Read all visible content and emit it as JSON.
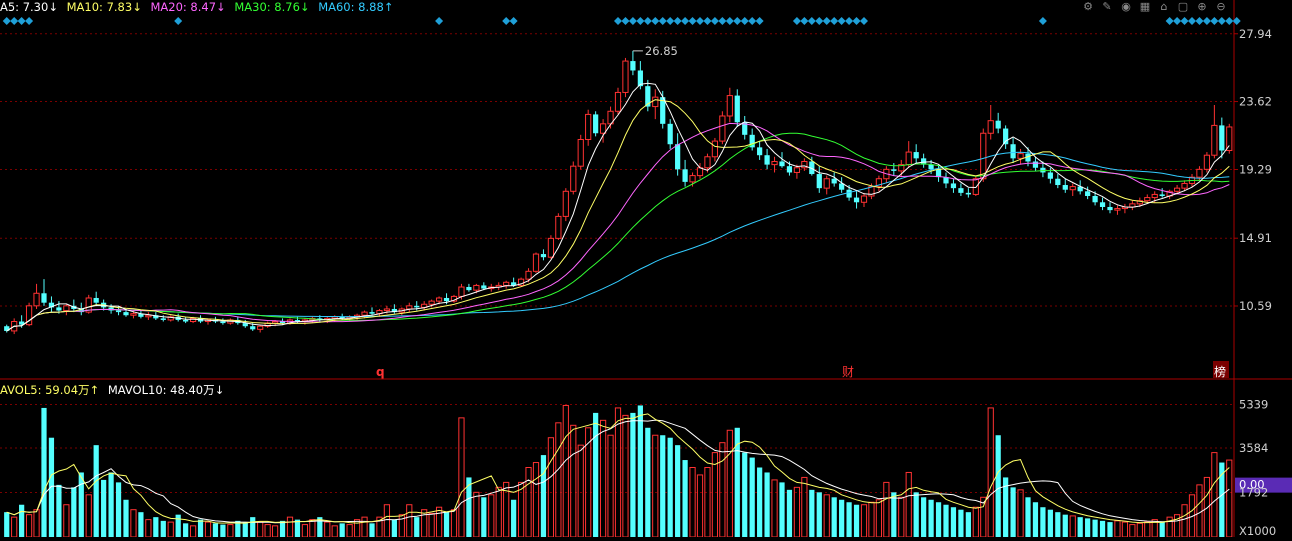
{
  "price_legend": [
    {
      "label": "A5: 7.30",
      "arrow": "↓",
      "color": "#ffffff"
    },
    {
      "label": "MA10: 7.83",
      "arrow": "↓",
      "color": "#ffff66"
    },
    {
      "label": "MA20: 8.47",
      "arrow": "↓",
      "color": "#ff66ff"
    },
    {
      "label": "MA30: 8.76",
      "arrow": "↓",
      "color": "#33ff33"
    },
    {
      "label": "MA60: 8.88",
      "arrow": "↑",
      "color": "#33ccff"
    }
  ],
  "vol_legend": [
    {
      "label": "AVOL5: 59.04万",
      "arrow": "↑",
      "color": "#ffff66"
    },
    {
      "label": "MAVOL10: 48.40万",
      "arrow": "↓",
      "color": "#ffffff"
    }
  ],
  "toolbar_icons": [
    "gear-icon",
    "pen-icon",
    "eye-icon",
    "calendar-icon",
    "house-icon",
    "lock-icon",
    "plus-icon",
    "minus-icon"
  ],
  "markers": {
    "q": "q",
    "cai": "财",
    "bang": "榜"
  },
  "high_label": "26.85",
  "price_axis": [
    "27.94",
    "23.62",
    "19.29",
    "14.91",
    "10.59"
  ],
  "vol_axis": [
    "5339",
    "3584",
    "0.00",
    "1792",
    "X1000"
  ],
  "colors": {
    "up": "#ff3232",
    "down": "#54ffff",
    "grid": "#7a0000",
    "axis": "#aa0000",
    "diamond": "#1fa0d8"
  },
  "chart_data": {
    "type": "candlestick",
    "price_ylim": [
      6.0,
      29.2
    ],
    "vol_ylim": [
      0,
      5600
    ],
    "price_ticks": [
      27.94,
      23.62,
      19.29,
      14.91,
      10.59
    ],
    "vol_ticks": [
      5339,
      3584,
      1792
    ],
    "volume_unit": "X1000",
    "bars": [
      [
        9.3,
        9.4,
        8.9,
        9.0,
        1000
      ],
      [
        9.0,
        9.8,
        8.8,
        9.6,
        800
      ],
      [
        9.6,
        10.0,
        9.2,
        9.4,
        1300
      ],
      [
        9.4,
        10.8,
        9.3,
        10.6,
        900
      ],
      [
        10.6,
        12.0,
        10.4,
        11.4,
        1100
      ],
      [
        11.4,
        12.3,
        10.6,
        10.8,
        5200
      ],
      [
        10.8,
        11.2,
        10.2,
        10.5,
        4000
      ],
      [
        10.5,
        10.9,
        10.1,
        10.3,
        2100
      ],
      [
        10.3,
        10.7,
        10.0,
        10.6,
        1300
      ],
      [
        10.6,
        11.0,
        10.2,
        10.4,
        2000
      ],
      [
        10.4,
        10.8,
        10.0,
        10.2,
        2600
      ],
      [
        10.2,
        11.3,
        10.1,
        11.1,
        1700
      ],
      [
        11.1,
        11.5,
        10.6,
        10.8,
        3700
      ],
      [
        10.8,
        11.0,
        10.3,
        10.5,
        2300
      ],
      [
        10.5,
        10.7,
        10.1,
        10.3,
        2600
      ],
      [
        10.3,
        10.6,
        10.0,
        10.2,
        2200
      ],
      [
        10.2,
        10.4,
        9.9,
        10.0,
        1500
      ],
      [
        10.0,
        10.3,
        9.8,
        10.1,
        1100
      ],
      [
        10.1,
        10.3,
        9.8,
        9.9,
        1000
      ],
      [
        9.9,
        10.2,
        9.7,
        10.0,
        700
      ],
      [
        10.0,
        10.2,
        9.7,
        9.8,
        800
      ],
      [
        9.8,
        10.0,
        9.6,
        9.7,
        650
      ],
      [
        9.7,
        10.0,
        9.6,
        9.9,
        600
      ],
      [
        9.9,
        10.1,
        9.6,
        9.7,
        900
      ],
      [
        9.7,
        9.9,
        9.5,
        9.6,
        550
      ],
      [
        9.6,
        9.9,
        9.5,
        9.8,
        450
      ],
      [
        9.8,
        10.0,
        9.5,
        9.6,
        700
      ],
      [
        9.6,
        9.8,
        9.4,
        9.7,
        600
      ],
      [
        9.7,
        9.9,
        9.5,
        9.6,
        550
      ],
      [
        9.6,
        9.8,
        9.4,
        9.5,
        500
      ],
      [
        9.5,
        9.8,
        9.4,
        9.7,
        500
      ],
      [
        9.7,
        9.9,
        9.4,
        9.5,
        650
      ],
      [
        9.5,
        9.7,
        9.2,
        9.3,
        600
      ],
      [
        9.3,
        9.5,
        9.0,
        9.1,
        800
      ],
      [
        9.1,
        9.4,
        8.9,
        9.3,
        600
      ],
      [
        9.3,
        9.6,
        9.2,
        9.5,
        500
      ],
      [
        9.5,
        9.7,
        9.3,
        9.6,
        450
      ],
      [
        9.6,
        9.8,
        9.4,
        9.5,
        650
      ],
      [
        9.5,
        9.8,
        9.4,
        9.7,
        800
      ],
      [
        9.7,
        9.9,
        9.5,
        9.6,
        700
      ],
      [
        9.6,
        9.8,
        9.4,
        9.7,
        500
      ],
      [
        9.7,
        9.9,
        9.5,
        9.8,
        700
      ],
      [
        9.8,
        10.0,
        9.6,
        9.7,
        800
      ],
      [
        9.7,
        9.9,
        9.5,
        9.8,
        600
      ],
      [
        9.8,
        10.0,
        9.6,
        9.9,
        450
      ],
      [
        9.9,
        10.1,
        9.7,
        9.8,
        550
      ],
      [
        9.8,
        10.0,
        9.6,
        9.9,
        500
      ],
      [
        9.9,
        10.1,
        9.7,
        10.0,
        700
      ],
      [
        10.0,
        10.3,
        9.8,
        10.2,
        800
      ],
      [
        10.2,
        10.5,
        10.0,
        10.1,
        550
      ],
      [
        10.1,
        10.4,
        9.9,
        10.3,
        800
      ],
      [
        10.3,
        10.6,
        10.1,
        10.4,
        1300
      ],
      [
        10.4,
        10.7,
        10.1,
        10.2,
        700
      ],
      [
        10.2,
        10.5,
        10.0,
        10.4,
        900
      ],
      [
        10.4,
        10.8,
        10.2,
        10.6,
        1300
      ],
      [
        10.6,
        10.9,
        10.3,
        10.5,
        800
      ],
      [
        10.5,
        10.9,
        10.3,
        10.7,
        1100
      ],
      [
        10.7,
        11.0,
        10.5,
        10.9,
        950
      ],
      [
        10.9,
        11.2,
        10.7,
        11.1,
        1200
      ],
      [
        11.1,
        11.4,
        10.7,
        10.9,
        1000
      ],
      [
        10.9,
        11.3,
        10.8,
        11.2,
        1100
      ],
      [
        11.2,
        12.0,
        11.0,
        11.8,
        4800
      ],
      [
        11.8,
        12.0,
        11.5,
        11.6,
        2400
      ],
      [
        11.6,
        12.0,
        11.4,
        11.9,
        1800
      ],
      [
        11.9,
        12.1,
        11.6,
        11.7,
        1600
      ],
      [
        11.7,
        12.0,
        11.5,
        11.8,
        1700
      ],
      [
        11.8,
        12.1,
        11.6,
        11.9,
        2000
      ],
      [
        11.9,
        12.2,
        11.7,
        12.1,
        2200
      ],
      [
        12.1,
        12.4,
        11.8,
        11.9,
        1500
      ],
      [
        11.9,
        12.4,
        11.8,
        12.3,
        2200
      ],
      [
        12.3,
        13.0,
        12.1,
        12.8,
        2800
      ],
      [
        12.8,
        14.0,
        12.7,
        13.9,
        3000
      ],
      [
        13.9,
        14.2,
        13.5,
        13.7,
        3300
      ],
      [
        13.7,
        15.1,
        13.6,
        14.9,
        4000
      ],
      [
        14.9,
        16.5,
        14.8,
        16.3,
        4600
      ],
      [
        16.3,
        18.1,
        16.0,
        17.9,
        5300
      ],
      [
        17.9,
        19.8,
        17.7,
        19.5,
        4500
      ],
      [
        19.5,
        21.5,
        19.3,
        21.2,
        3700
      ],
      [
        21.2,
        23.1,
        20.8,
        22.8,
        4400
      ],
      [
        22.8,
        23.0,
        21.4,
        21.6,
        5000
      ],
      [
        21.6,
        22.5,
        21.0,
        22.2,
        4700
      ],
      [
        22.2,
        23.3,
        21.9,
        23.0,
        4100
      ],
      [
        23.0,
        24.5,
        22.8,
        24.2,
        5200
      ],
      [
        24.2,
        26.4,
        23.9,
        26.2,
        4900
      ],
      [
        26.2,
        26.85,
        25.3,
        25.6,
        5000
      ],
      [
        25.6,
        26.2,
        24.4,
        24.6,
        5300
      ],
      [
        24.6,
        25.0,
        23.0,
        23.3,
        4400
      ],
      [
        23.3,
        24.4,
        22.5,
        23.9,
        4100
      ],
      [
        23.9,
        24.3,
        21.9,
        22.2,
        4100
      ],
      [
        22.2,
        22.5,
        20.6,
        20.9,
        4000
      ],
      [
        20.9,
        21.6,
        18.9,
        19.3,
        3700
      ],
      [
        19.3,
        19.9,
        18.2,
        18.5,
        3100
      ],
      [
        18.5,
        19.1,
        18.2,
        18.9,
        2800
      ],
      [
        18.9,
        19.7,
        18.7,
        19.4,
        2500
      ],
      [
        19.4,
        20.3,
        19.1,
        20.1,
        2800
      ],
      [
        20.1,
        21.3,
        19.8,
        21.1,
        3400
      ],
      [
        21.1,
        23.0,
        20.9,
        22.7,
        3800
      ],
      [
        22.7,
        24.5,
        22.3,
        24.0,
        4300
      ],
      [
        24.0,
        24.4,
        22.0,
        22.3,
        4400
      ],
      [
        22.3,
        22.7,
        21.2,
        21.5,
        3400
      ],
      [
        21.5,
        21.9,
        20.5,
        20.7,
        3200
      ],
      [
        20.7,
        21.1,
        19.9,
        20.2,
        2800
      ],
      [
        20.2,
        20.6,
        19.3,
        19.6,
        2600
      ],
      [
        19.6,
        20.1,
        19.1,
        19.8,
        2300
      ],
      [
        19.8,
        20.4,
        19.4,
        19.5,
        2200
      ],
      [
        19.5,
        19.8,
        18.9,
        19.1,
        1900
      ],
      [
        19.1,
        19.6,
        18.7,
        19.4,
        2000
      ],
      [
        19.4,
        20.0,
        19.2,
        19.8,
        2400
      ],
      [
        19.8,
        20.1,
        18.9,
        19.0,
        1900
      ],
      [
        19.0,
        19.5,
        17.8,
        18.1,
        1800
      ],
      [
        18.1,
        18.9,
        17.7,
        18.7,
        1700
      ],
      [
        18.7,
        19.1,
        18.2,
        18.4,
        1600
      ],
      [
        18.4,
        18.8,
        17.8,
        18.0,
        1500
      ],
      [
        18.0,
        18.3,
        17.3,
        17.5,
        1400
      ],
      [
        17.5,
        17.9,
        16.8,
        17.2,
        1300
      ],
      [
        17.2,
        17.8,
        16.9,
        17.6,
        1300
      ],
      [
        17.6,
        18.4,
        17.4,
        18.2,
        1400
      ],
      [
        18.2,
        18.9,
        17.9,
        18.7,
        1500
      ],
      [
        18.7,
        19.5,
        18.4,
        19.3,
        2200
      ],
      [
        19.3,
        19.7,
        18.9,
        19.2,
        1800
      ],
      [
        19.2,
        19.9,
        18.8,
        19.6,
        1600
      ],
      [
        19.6,
        21.1,
        19.4,
        20.4,
        2600
      ],
      [
        20.4,
        20.9,
        19.7,
        20.0,
        1800
      ],
      [
        20.0,
        20.3,
        19.4,
        19.6,
        1600
      ],
      [
        19.6,
        19.9,
        19.0,
        19.3,
        1500
      ],
      [
        19.3,
        19.6,
        18.5,
        18.8,
        1400
      ],
      [
        18.8,
        19.1,
        18.1,
        18.4,
        1300
      ],
      [
        18.4,
        18.7,
        17.8,
        18.1,
        1200
      ],
      [
        18.1,
        18.4,
        17.6,
        17.8,
        1100
      ],
      [
        17.8,
        18.1,
        17.5,
        17.7,
        1000
      ],
      [
        17.7,
        18.9,
        17.6,
        18.7,
        1200
      ],
      [
        18.7,
        21.9,
        18.5,
        21.6,
        1600
      ],
      [
        21.6,
        23.4,
        21.2,
        22.4,
        5200
      ],
      [
        22.4,
        22.9,
        21.6,
        21.9,
        4100
      ],
      [
        21.9,
        22.1,
        20.6,
        20.9,
        2400
      ],
      [
        20.9,
        21.3,
        19.7,
        20.0,
        2000
      ],
      [
        20.0,
        20.6,
        19.6,
        20.3,
        1900
      ],
      [
        20.3,
        20.7,
        19.5,
        19.8,
        1600
      ],
      [
        19.8,
        20.1,
        19.2,
        19.4,
        1400
      ],
      [
        19.4,
        19.8,
        18.8,
        19.1,
        1200
      ],
      [
        19.1,
        19.4,
        18.4,
        18.7,
        1100
      ],
      [
        18.7,
        19.0,
        18.1,
        18.3,
        1000
      ],
      [
        18.3,
        18.7,
        17.8,
        18.0,
        900
      ],
      [
        18.0,
        18.4,
        17.6,
        18.2,
        850
      ],
      [
        18.2,
        18.6,
        17.7,
        17.9,
        800
      ],
      [
        17.9,
        18.2,
        17.4,
        17.6,
        750
      ],
      [
        17.6,
        17.9,
        17.0,
        17.2,
        700
      ],
      [
        17.2,
        17.5,
        16.7,
        16.9,
        650
      ],
      [
        16.9,
        17.2,
        16.5,
        16.7,
        600
      ],
      [
        16.7,
        17.0,
        16.4,
        16.8,
        650
      ],
      [
        16.8,
        17.1,
        16.5,
        16.9,
        600
      ],
      [
        16.9,
        17.3,
        16.7,
        17.1,
        500
      ],
      [
        17.1,
        17.5,
        16.9,
        17.3,
        550
      ],
      [
        17.3,
        17.7,
        17.1,
        17.5,
        600
      ],
      [
        17.5,
        17.9,
        17.2,
        17.7,
        700
      ],
      [
        17.7,
        18.1,
        17.5,
        17.6,
        600
      ],
      [
        17.6,
        18.0,
        17.4,
        17.9,
        800
      ],
      [
        17.9,
        18.3,
        17.7,
        18.1,
        900
      ],
      [
        18.1,
        18.6,
        17.9,
        18.4,
        1300
      ],
      [
        18.4,
        19.0,
        18.2,
        18.8,
        1700
      ],
      [
        18.8,
        19.5,
        18.6,
        19.3,
        2100
      ],
      [
        19.3,
        20.4,
        19.1,
        20.2,
        2400
      ],
      [
        20.2,
        23.4,
        20.0,
        22.1,
        3400
      ],
      [
        22.1,
        22.6,
        20.0,
        20.5,
        3000
      ],
      [
        20.5,
        22.2,
        20.3,
        22.0,
        3100
      ]
    ],
    "ma_series": [
      {
        "name": "A5",
        "color": "#ffffff",
        "period": 5
      },
      {
        "name": "MA10",
        "color": "#ffff66",
        "period": 10
      },
      {
        "name": "MA20",
        "color": "#ff66ff",
        "period": 20
      },
      {
        "name": "MA30",
        "color": "#33ff33",
        "period": 30
      },
      {
        "name": "MA60",
        "color": "#33ccff",
        "period": 60
      }
    ],
    "vol_series": [
      {
        "name": "AVOL5",
        "color": "#ffff66",
        "period": 5
      },
      {
        "name": "MAVOL10",
        "color": "#ffffff",
        "period": 10
      }
    ],
    "diamond_bars": [
      0,
      1,
      2,
      3,
      23,
      58,
      67,
      68,
      82,
      83,
      84,
      85,
      86,
      87,
      88,
      89,
      90,
      91,
      92,
      93,
      94,
      95,
      96,
      97,
      98,
      99,
      100,
      101,
      106,
      107,
      108,
      109,
      110,
      111,
      112,
      113,
      114,
      115,
      139,
      156,
      157,
      158,
      159,
      160,
      161,
      162,
      163,
      164,
      165,
      190,
      198
    ]
  }
}
